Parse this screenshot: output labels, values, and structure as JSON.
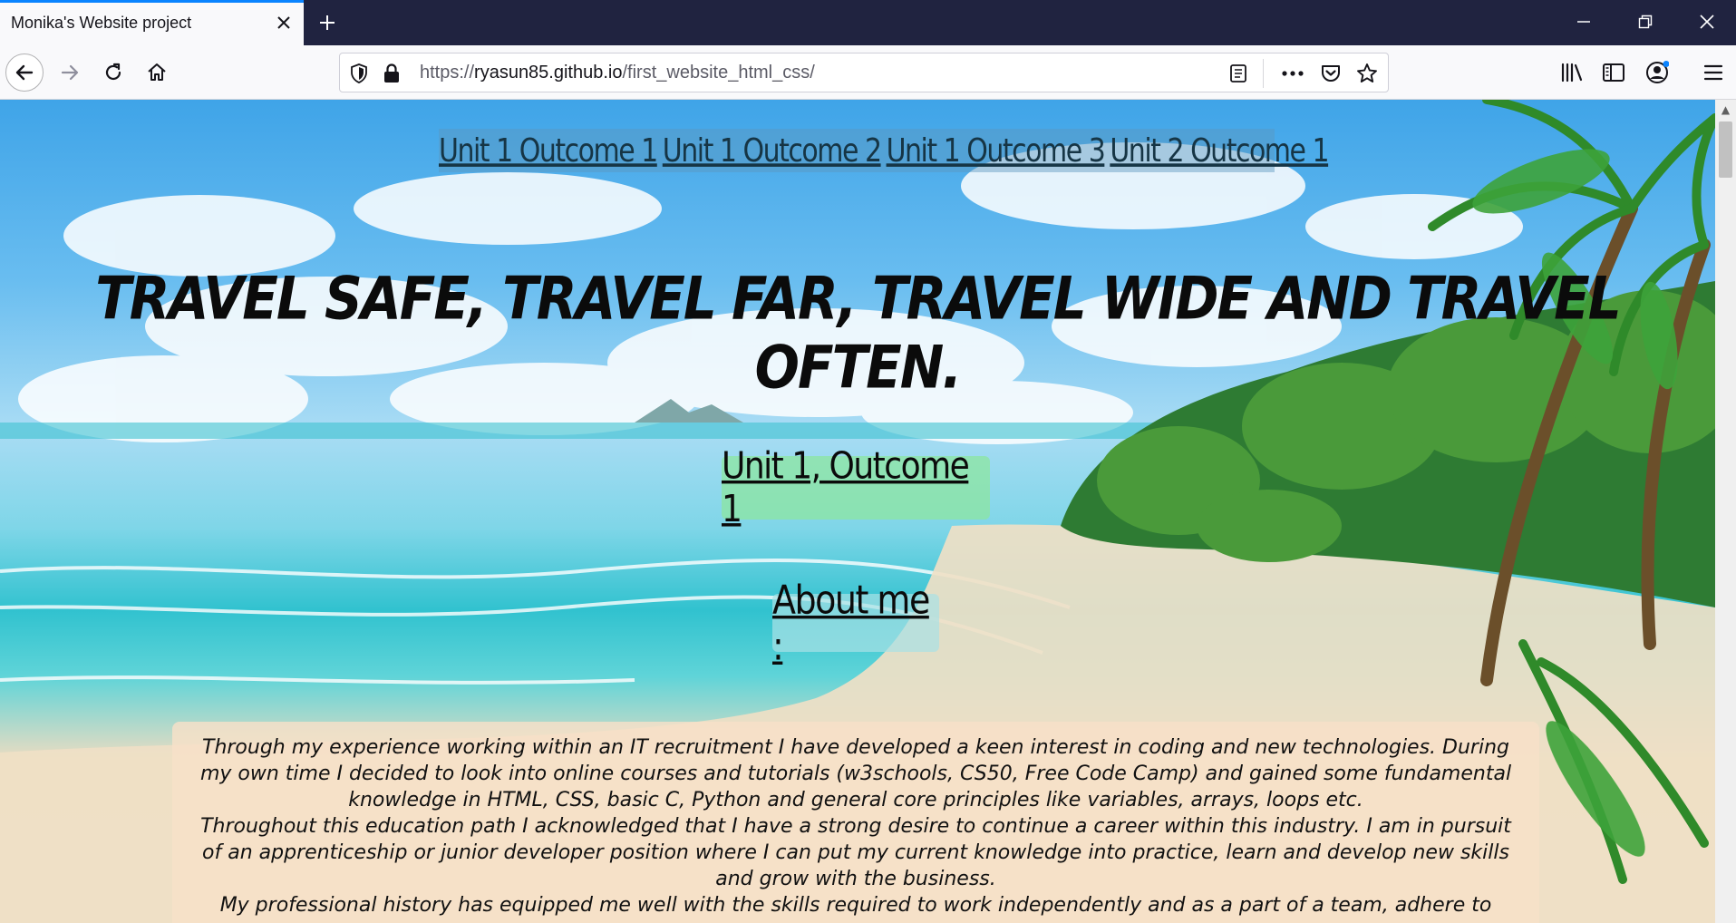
{
  "browser": {
    "tab_title": "Monika's Website project",
    "url_scheme": "https://",
    "url_host": "ryasun85.github.io",
    "url_path": "/first_website_html_css/",
    "icons": [
      "close-icon",
      "plus-icon",
      "minimize-icon",
      "restore-icon",
      "window-close-icon",
      "back-icon",
      "forward-icon",
      "reload-icon",
      "home-icon",
      "shield-icon",
      "lock-icon",
      "reader-view-icon",
      "more-icon",
      "pocket-icon",
      "star-icon",
      "library-icon",
      "sidebar-icon",
      "account-icon",
      "menu-icon"
    ],
    "accent": "#0a84ff"
  },
  "page": {
    "nav": [
      "Unit 1 Outcome 1",
      "Unit 1 Outcome 2",
      "Unit 1 Outcome 3",
      "Unit 2 Outcome 1"
    ],
    "headline": "Travel safe, travel far, travel wide and travel often.",
    "section_title": "Unit 1, Outcome 1",
    "about_title": "About me :",
    "about_paragraphs": [
      "Through my experience working within an IT recruitment I have developed a keen interest in coding and new technologies. During my own time I decided to look into online courses and tutorials (w3schools, CS50, Free Code Camp) and gained some fundamental knowledge in HTML, CSS, basic C, Python and general core principles like variables, arrays, loops etc.",
      "Throughout this education path I acknowledged that I have a strong desire to continue a career within this industry. I am in pursuit of an apprenticeship or junior developer position where I can put my current knowledge into practice, learn and develop new skills and grow with the business.",
      "My professional history has equipped me well with the skills required to work independently and as a part of a team, adhere to"
    ]
  }
}
